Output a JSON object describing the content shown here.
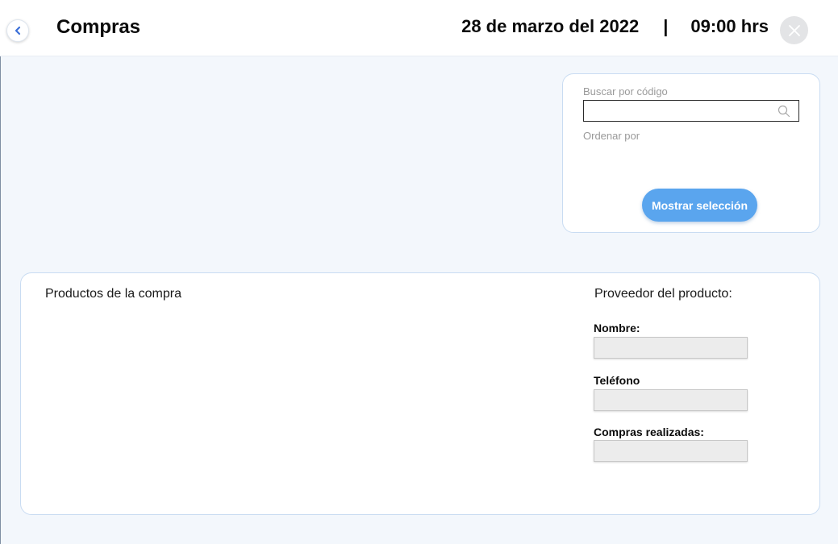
{
  "header": {
    "title": "Compras",
    "date": "28 de marzo del 2022",
    "separator": "|",
    "time": "09:00 hrs",
    "back_icon": "chevron-left-icon",
    "close_icon": "close-icon"
  },
  "search_panel": {
    "search_label": "Buscar por código",
    "search_value": "",
    "search_icon": "search-icon",
    "sort_label": "Ordenar por",
    "show_button_label": "Mostrar selección"
  },
  "products_panel": {
    "title": "Productos de la compra",
    "provider_title": "Proveedor del producto:",
    "fields": [
      {
        "label": "Nombre:",
        "value": ""
      },
      {
        "label": "Teléfono",
        "value": ""
      },
      {
        "label": "Compras realizadas:",
        "value": ""
      }
    ]
  },
  "colors": {
    "accent": "#5aa5ee",
    "back_chevron": "#3b6fd8",
    "panel_border": "#c9dcf2",
    "background": "#f3f7fc"
  }
}
